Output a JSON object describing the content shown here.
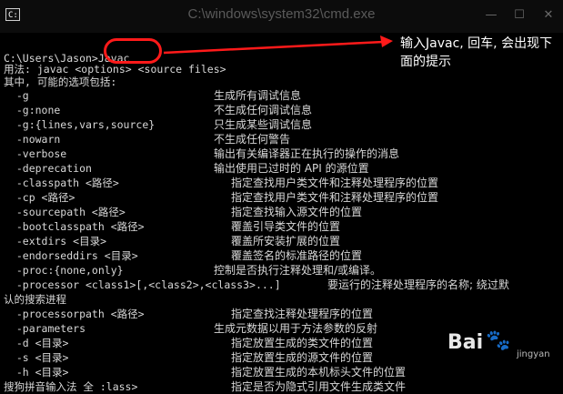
{
  "window": {
    "title": "C:\\windows\\system32\\cmd.exe",
    "icon": "cmd-icon",
    "minimize": "—",
    "maximize": "☐",
    "close": "✕"
  },
  "terminal": {
    "prompt": "C:\\Users\\Jason>Javac",
    "usage": "用法: javac <options> <source files>",
    "options_header": "其中, 可能的选项包括:",
    "options": [
      {
        "flag": "  -g",
        "desc": "生成所有调试信息"
      },
      {
        "flag": "  -g:none",
        "desc": "不生成任何调试信息"
      },
      {
        "flag": "  -g:{lines,vars,source}",
        "desc": "只生成某些调试信息"
      },
      {
        "flag": "  -nowarn",
        "desc": "不生成任何警告"
      },
      {
        "flag": "  -verbose",
        "desc": "输出有关编译器正在执行的操作的消息"
      },
      {
        "flag": "  -deprecation",
        "desc": "输出使用已过时的 API 的源位置"
      },
      {
        "flag": "  -classpath <路径>",
        "desc": "指定查找用户类文件和注释处理程序的位置"
      },
      {
        "flag": "  -cp <路径>",
        "desc": "指定查找用户类文件和注释处理程序的位置"
      },
      {
        "flag": "  -sourcepath <路径>",
        "desc": "指定查找输入源文件的位置"
      },
      {
        "flag": "  -bootclasspath <路径>",
        "desc": "覆盖引导类文件的位置"
      },
      {
        "flag": "  -extdirs <目录>",
        "desc": "覆盖所安装扩展的位置"
      },
      {
        "flag": "  -endorseddirs <目录>",
        "desc": "覆盖签名的标准路径的位置"
      },
      {
        "flag": "  -proc:{none,only}",
        "desc": "控制是否执行注释处理和/或编译。"
      },
      {
        "flag": "  -processor <class1>[,<class2>,<class3>...]",
        "desc": "要运行的注释处理程序的名称; 绕过默"
      },
      {
        "flag": "认的搜索进程",
        "desc": ""
      },
      {
        "flag": "  -processorpath <路径>",
        "desc": "指定查找注释处理程序的位置"
      },
      {
        "flag": "  -parameters",
        "desc": "生成元数据以用于方法参数的反射"
      },
      {
        "flag": "  -d <目录>",
        "desc": "指定放置生成的类文件的位置"
      },
      {
        "flag": "  -s <目录>",
        "desc": "指定放置生成的源文件的位置"
      },
      {
        "flag": "  -h <目录>",
        "desc": "指定放置生成的本机标头文件的位置"
      },
      {
        "flag": "搜狗拼音输入法 全 :lass>",
        "desc": "指定是否为隐式引用文件生成类文件"
      }
    ]
  },
  "annotation": {
    "text": "输入Javac, 回车, 会出现下面的提示",
    "color": "#ff1a1a"
  },
  "watermark": {
    "brand": "Bai",
    "paw": "🐾",
    "sub": "jingyan"
  }
}
